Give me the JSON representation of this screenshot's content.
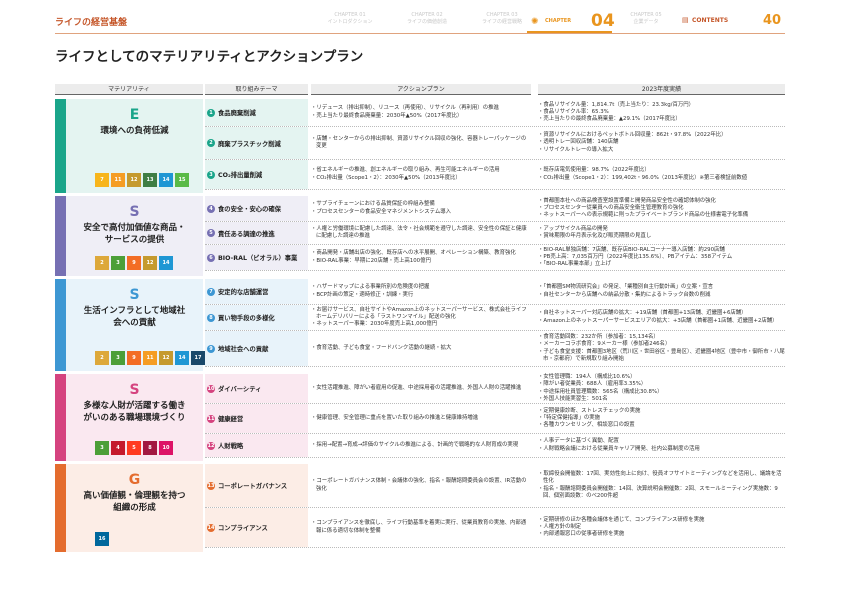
{
  "header": {
    "brand": "ライフの経営基盤",
    "chapters": [
      {
        "num": "CHAPTER 01",
        "name": "イントロダクション"
      },
      {
        "num": "CHAPTER 02",
        "name": "ライフの価値創造"
      },
      {
        "num": "CHAPTER 03",
        "name": "ライフの経営戦略"
      }
    ],
    "current": {
      "label": "CHAPTER",
      "num": "04"
    },
    "chapter5": {
      "num": "CHAPTER 05",
      "name": "企業データ"
    },
    "contents": "CONTENTS",
    "page": "40"
  },
  "page_title": "ライフとしてのマテリアリティとアクションプラン",
  "table": {
    "headers": [
      "マテリアリティ",
      "取り組みテーマ",
      "アクションプラン",
      "2023年度実績"
    ],
    "groups": [
      {
        "letter": "E",
        "name": "環境への負荷低減",
        "color": "#1aa58a",
        "sdgs": [
          {
            "n": "7",
            "c": "#f7b51b"
          },
          {
            "n": "11",
            "c": "#f59d24"
          },
          {
            "n": "12",
            "c": "#c59a2e"
          },
          {
            "n": "13",
            "c": "#3f7e44"
          },
          {
            "n": "14",
            "c": "#1f97d4"
          },
          {
            "n": "15",
            "c": "#59ba47"
          }
        ],
        "rows": [
          {
            "n": "1",
            "theme": "食品廃棄削減",
            "plan": [
              "リデュース（排出抑制）、リユース（再使用）、リサイクル（再利用）の推進",
              "売上当たり最終食品廃棄量：2030年▲50%（2017年度比）"
            ],
            "res": [
              "食品リサイクル量：1,814.7t（売上当たり：23.3kg/百万円）",
              "食品リサイクル率：65.3%",
              "売上当たりの最終食品廃棄量：▲29.1%（2017年度比）"
            ]
          },
          {
            "n": "2",
            "theme": "廃棄プラスチック削減",
            "plan": [
              "店舗・センターからの排出抑制、資源リサイクル回収の強化、容器トレーパッケージの変更"
            ],
            "res": [
              "資源リサイクルにおけるペットボトル回収量：862t・97.8%（2022年比）",
              "透明トレー回収店舗：140店舗",
              "リサイクルトレーの導入拡大"
            ]
          },
          {
            "n": "3",
            "theme": "CO₂排出量削減",
            "plan": [
              "省エネルギーの推進、創エネルギーの取り組み、再生可能エネルギーの活用",
              "CO₂排出量（Scope1・2）：2030年▲50%（2013年度比）"
            ],
            "res": [
              "既存店電気使用量：98.7%（2022年度比）",
              "CO₂排出量（Scope1・2）：199,402t・96.0%（2013年度比）※第三者検証前数値"
            ]
          }
        ]
      },
      {
        "letter": "S",
        "name": "安全で高付加価値な商品・サービスの提供",
        "color": "#7670b3",
        "sdgs": [
          {
            "n": "2",
            "c": "#dda83a"
          },
          {
            "n": "3",
            "c": "#4c9f38"
          },
          {
            "n": "9",
            "c": "#f36d25"
          },
          {
            "n": "12",
            "c": "#c59a2e"
          },
          {
            "n": "14",
            "c": "#1f97d4"
          }
        ],
        "rows": [
          {
            "n": "4",
            "theme": "食の安全・安心の確保",
            "plan": [
              "サプライチェーンにおける品質保証の枠組み整備",
              "プロセスセンターの食品安全マネジメントシステム導入"
            ],
            "res": [
              "首都圏本社への商品検査室設置準備と開発商品安全性の確認体制の強化",
              "プロセスセンター従業員への商品安全衛生管理教育の強化",
              "ネットスーパーへの表示規範に則ったプライベートブランド商品の仕様書電子化準備"
            ]
          },
          {
            "n": "5",
            "theme": "責任ある調達の推進",
            "plan": [
              "人権と労働環境に配慮した調達、法令・社会規範を遵守した調達、安全性の保証と健康に配慮した調達の推進"
            ],
            "res": [
              "アップサイクル商品の開発",
              "賞味期限の年月表示化及び販売期限の見直し"
            ]
          },
          {
            "n": "6",
            "theme": "BIO-RAL（ビオラル）事業",
            "plan": [
              "商品開発・店舗出店の強化、既存店への水平展開、オペレーション構築、教育強化",
              "BIO-RAL事業：早期に20店舗・売上高100億円"
            ],
            "res": [
              "BIO-RAL単独店舗：7店舗、既存店BIO-RALコーナー導入店舗：約290店舗",
              "PB売上高：7,035百万円（2022年度比135.6%）、PBアイテム：358アイテム",
              "「BIO-RAL事業本部」立上げ"
            ]
          }
        ]
      },
      {
        "letter": "S",
        "name": "生活インフラとして地域社会への貢献",
        "color": "#3d97d3",
        "sdgs": [
          {
            "n": "2",
            "c": "#dda83a"
          },
          {
            "n": "3",
            "c": "#4c9f38"
          },
          {
            "n": "9",
            "c": "#f36d25"
          },
          {
            "n": "11",
            "c": "#f59d24"
          },
          {
            "n": "12",
            "c": "#c59a2e"
          },
          {
            "n": "14",
            "c": "#1f97d4"
          },
          {
            "n": "17",
            "c": "#19486a"
          }
        ],
        "rows": [
          {
            "n": "7",
            "theme": "安定的な店舗運営",
            "plan": [
              "ハザードマップによる事業所別の危険度の把握",
              "BCP計画の策定・適時修正・訓練・実行"
            ],
            "res": [
              "「首都圏SM物流研究会」の発足、「業種別自主行動計画」の立案・宣言",
              "自社センターから店舗への納品分散・集約によるトラック台数の削減"
            ]
          },
          {
            "n": "8",
            "theme": "買い物手段の多様化",
            "plan": [
              "お届けサービス、自社サイトやAmazon上のネットスーパーサービス、株式会社ライフホームデリバリーによる「ラストワンマイル」配送の強化",
              "ネットスーパー事業：2030年度売上高1,000億円"
            ],
            "res": [
              "自社ネットスーパー対応店舗の拡大：+19店舗（首都圏+13店舗、近畿圏+6店舗）",
              "Amazon上のネットスーパーサービスエリアの拡大：+3店舗（首都圏+1店舗、近畿圏+2店舗）"
            ]
          },
          {
            "n": "9",
            "theme": "地域社会への貢献",
            "plan": [
              "食育活動、子ども食堂・フードバンク活動の継続・拡大"
            ],
            "res": [
              "食育活動回数：232か所（参加者：15,134名）",
              "メーカーコラボ食育：9メーカー様（参加者246名）",
              "子ども食堂支援：首都圏3地区（荒川区・世田谷区・豊島区）、近畿圏4地区（豊中市・御所市・八尾市・京都府）で新規取り組み開始"
            ]
          }
        ]
      },
      {
        "letter": "S",
        "name": "多様な人財が活躍する働きがいのある職場環境づくり",
        "color": "#d5437f",
        "sdgs": [
          {
            "n": "3",
            "c": "#4c9f38"
          },
          {
            "n": "4",
            "c": "#c5192d"
          },
          {
            "n": "5",
            "c": "#ff3a21"
          },
          {
            "n": "8",
            "c": "#a21942"
          },
          {
            "n": "10",
            "c": "#dd1367"
          }
        ],
        "rows": [
          {
            "n": "10",
            "theme": "ダイバーシティ",
            "plan": [
              "女性活躍推進、障がい者雇用の促進、中途採用者の活躍推進、外国人人財の活躍推進"
            ],
            "res": [
              "女性管理職：194人（構成比10.6%）",
              "障がい者従業員：688人（雇用率3.35%）",
              "中途採用社員管理職数：565名（構成比30.8%）",
              "外国人技能実習生：501名"
            ]
          },
          {
            "n": "11",
            "theme": "健康経営",
            "plan": [
              "健康管理、安全管理に重点を置いた取り組みの推進と健康維持増進"
            ],
            "res": [
              "定期健康診断、ストレスチェックの実施",
              "「特定保健指導」の実施",
              "各種カウンセリング、相談窓口の設置"
            ]
          },
          {
            "n": "12",
            "theme": "人財戦略",
            "plan": [
              "採用→配置→育成→評価のサイクルの推進による、計画的で戦略的な人財育成の実現"
            ],
            "res": [
              "人事データに基づく異動、配置",
              "人財戦略会議における従業員キャリア開発、社内公募制度の活用"
            ]
          }
        ]
      },
      {
        "letter": "G",
        "name": "高い価値観・倫理観を持つ組織の形成",
        "color": "#e46c2e",
        "sdgs": [
          {
            "n": "16",
            "c": "#00689d"
          }
        ],
        "rows": [
          {
            "n": "13",
            "theme": "コーポレートガバナンス",
            "plan": [
              "コーポレートガバナンス体制・会議体の強化、指名・報酬諮問委員会の設置、IR活動の強化"
            ],
            "res": [
              "取締役会開催数：17回、実効性向上に向け、役員オフサイトミーティングなどを活用し、議論を活性化",
              "指名・報酬諮問委員会開催数：14回、決算説明会開催数：2回、スモールミーティング実施数：9回、個別面談数：のべ200件超"
            ]
          },
          {
            "n": "14",
            "theme": "コンプライアンス",
            "plan": [
              "コンプライアンスを徹底し、ライフ行動基準を着実に実行、従業員教育の実施、内部通報に係る適切な体制を整備"
            ],
            "res": [
              "定期研修のほか各種会議体を通じて、コンプライアンス研修を実施",
              "人権方針の制定",
              "内部通報窓口の従事者研修を実施"
            ]
          }
        ]
      }
    ]
  }
}
